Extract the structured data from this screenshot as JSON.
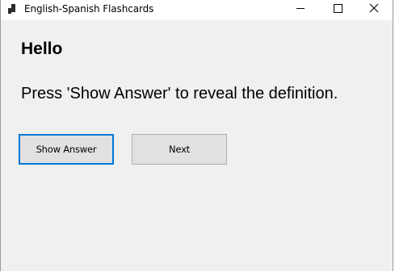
{
  "window": {
    "title": "English-Spanish Flashcards",
    "icon": "app-icon"
  },
  "caption_buttons": {
    "minimize": "minimize-icon",
    "maximize": "maximize-icon",
    "close": "close-icon"
  },
  "card": {
    "word": "Hello",
    "definition": "Press 'Show Answer' to reveal the definition."
  },
  "buttons": {
    "show_answer_label": "Show Answer",
    "next_label": "Next"
  },
  "colors": {
    "focus_border": "#0078d7",
    "button_face": "#e1e1e1",
    "form_background": "#f0f0f0"
  }
}
